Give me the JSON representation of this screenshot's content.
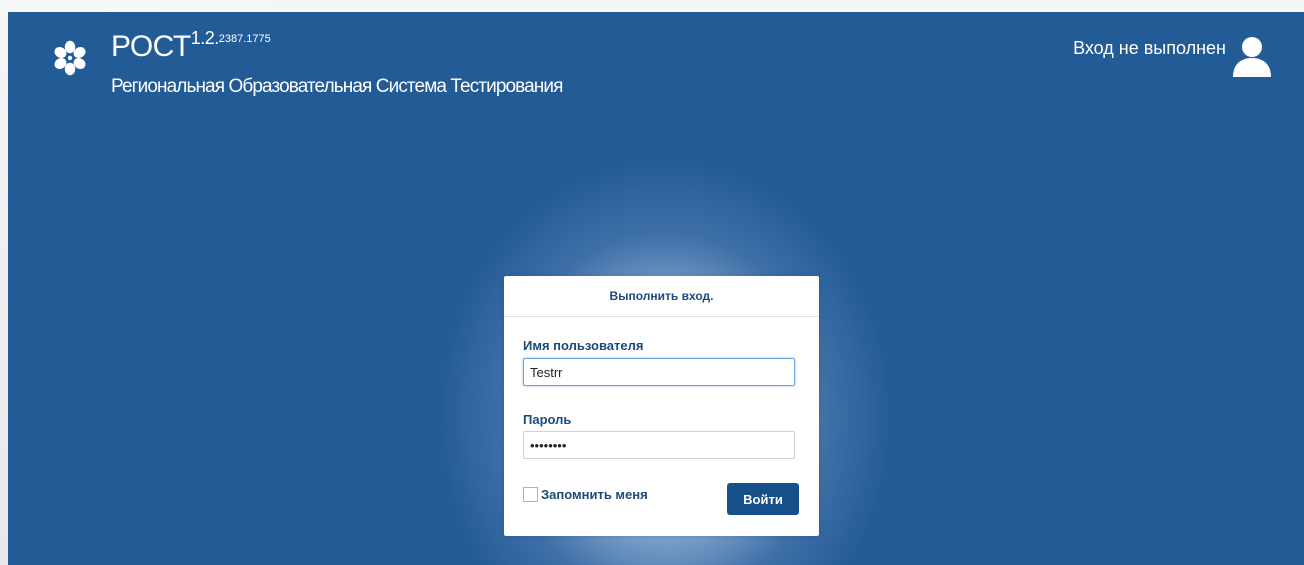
{
  "header": {
    "brand_name": "РОСТ",
    "version": "1.2.",
    "build": "2387.1775",
    "subtitle": "Региональная Образовательная Система Тестирования",
    "login_status": "Вход не выполнен"
  },
  "icons": {
    "logo": "flower-logo-icon",
    "user": "user-icon"
  },
  "login": {
    "title": "Выполнить вход.",
    "username_label": "Имя пользователя",
    "username_value": "Testrr",
    "password_label": "Пароль",
    "password_value": "password",
    "remember_label": "Запомнить меня",
    "remember_checked": false,
    "submit_label": "Войти"
  },
  "colors": {
    "background": "#235b96",
    "accent": "#15508a",
    "label_text": "#1d4a7a"
  }
}
